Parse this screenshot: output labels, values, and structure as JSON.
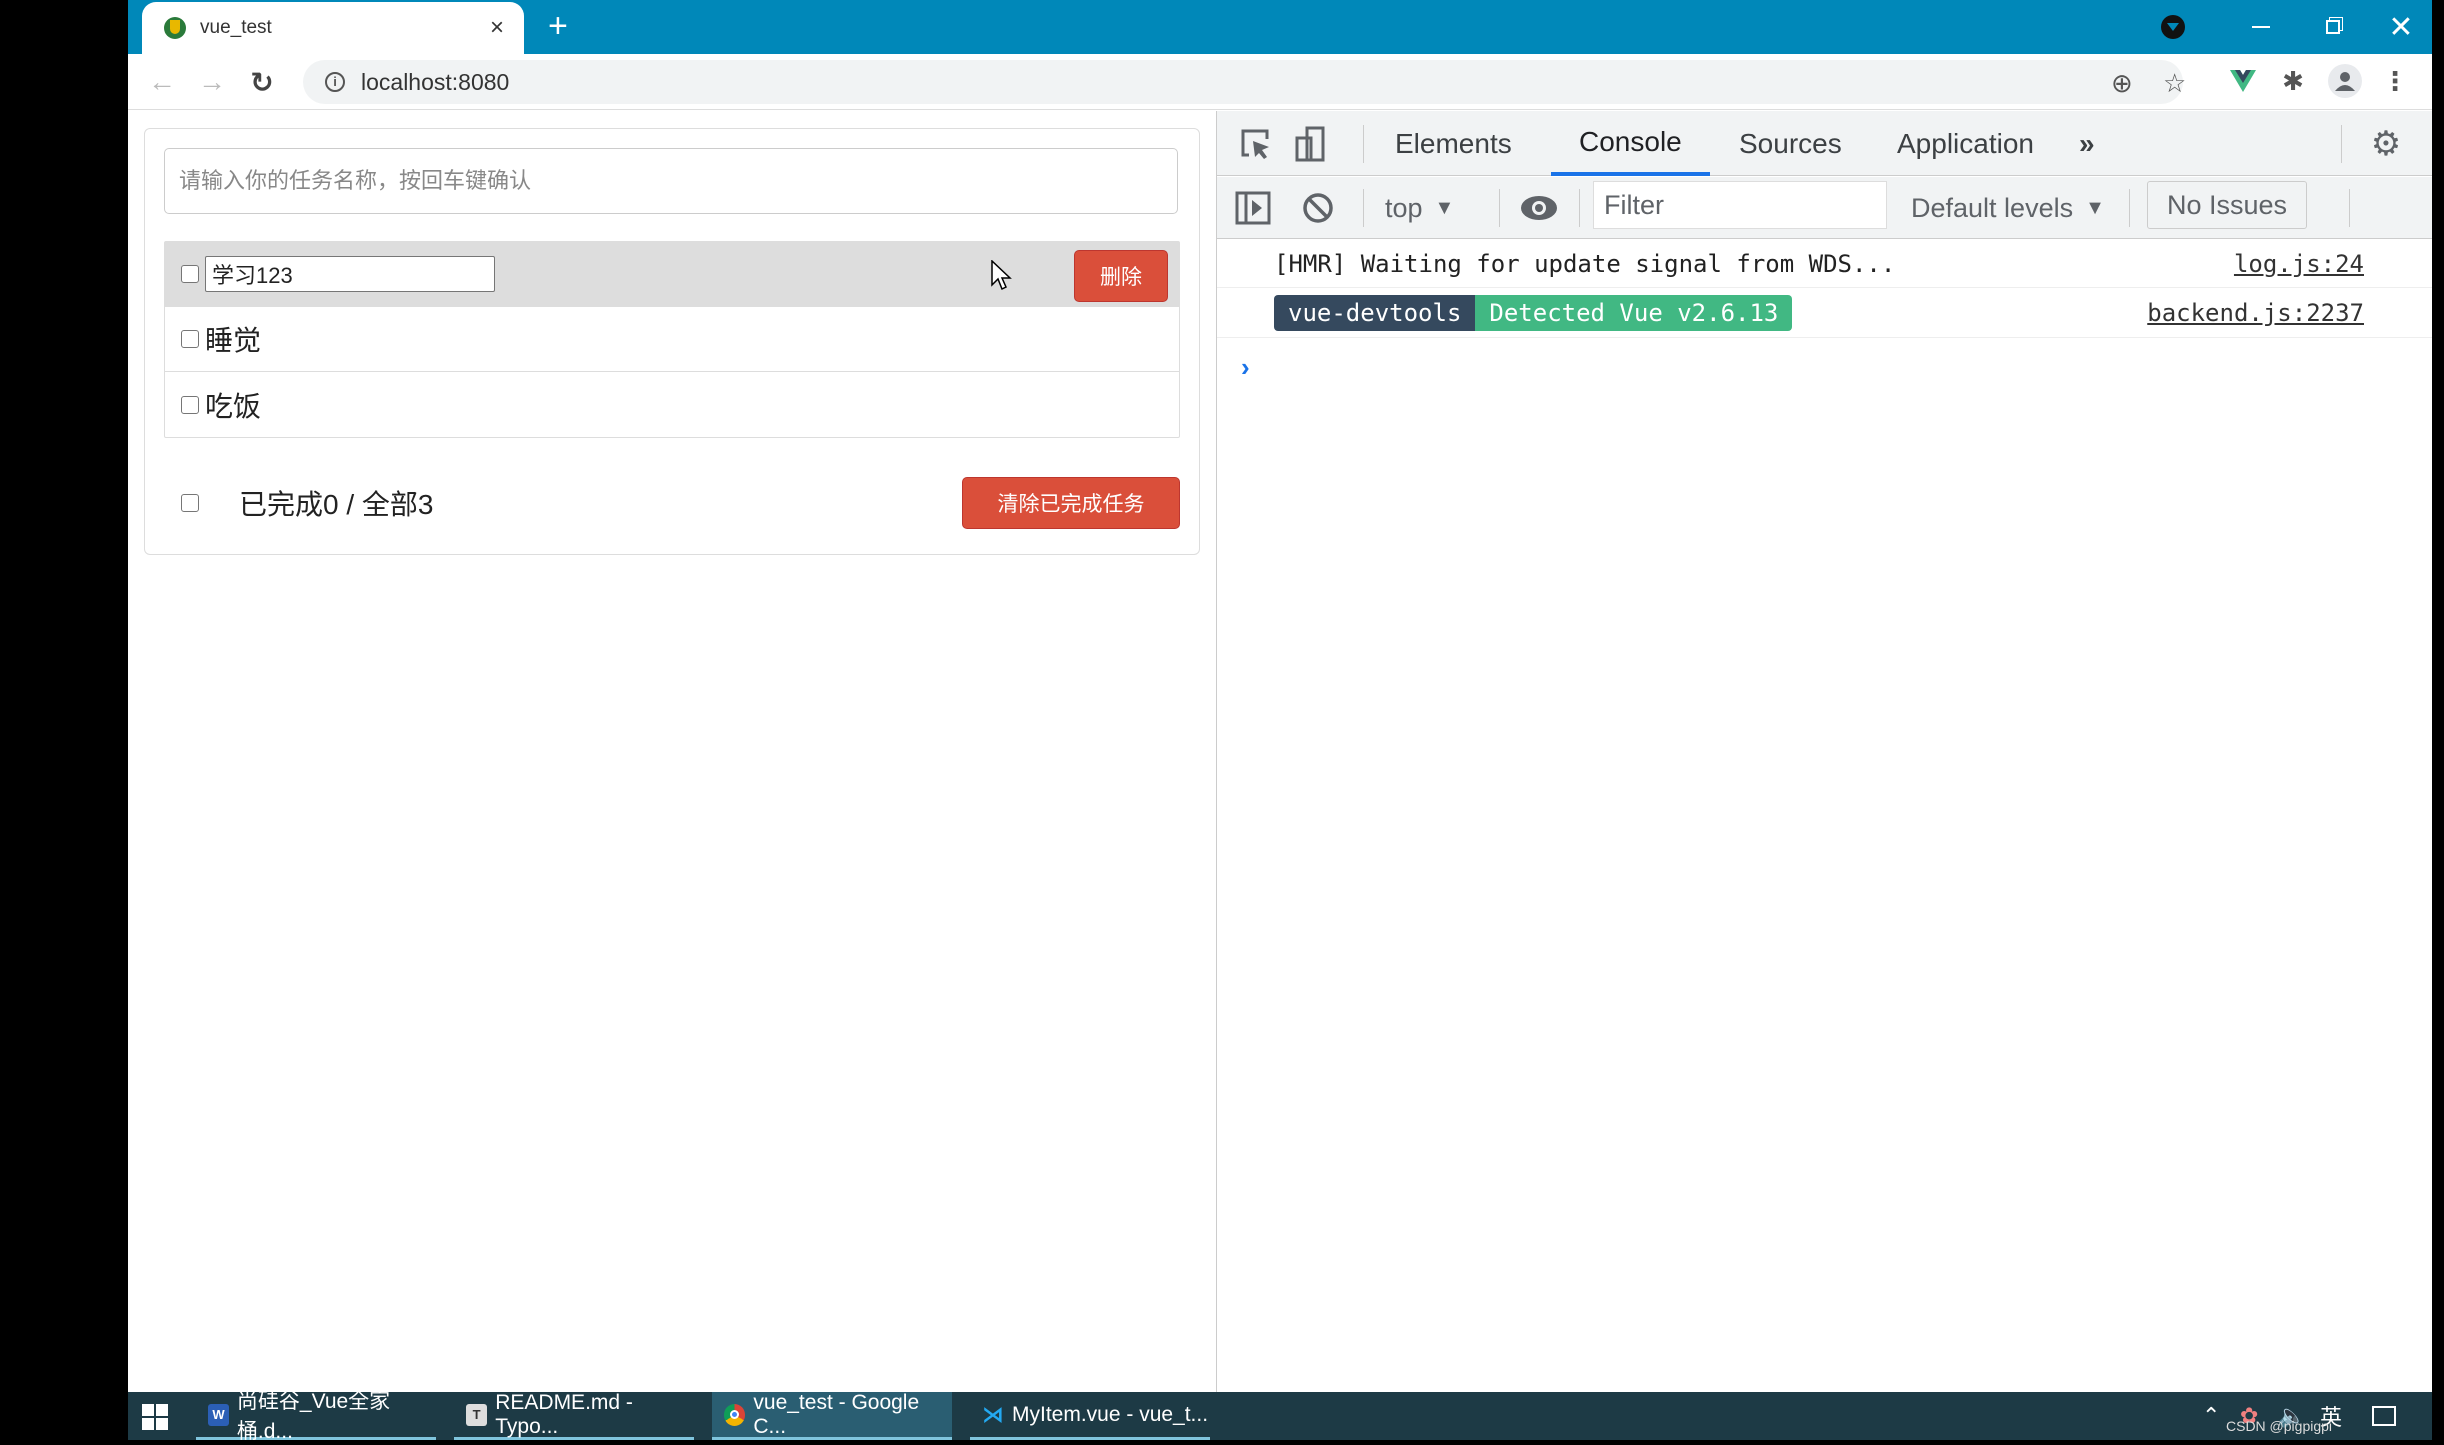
{
  "browser": {
    "tab_title": "vue_test",
    "url": "localhost:8080",
    "new_tab_symbol": "+",
    "close_tab_symbol": "×"
  },
  "todo": {
    "input_placeholder": "请输入你的任务名称，按回车键确认",
    "input_value": "",
    "items": [
      {
        "title": "学习123",
        "done": false,
        "editing": true,
        "hovered": true
      },
      {
        "title": "睡觉",
        "done": false,
        "editing": false,
        "hovered": false
      },
      {
        "title": "吃饭",
        "done": false,
        "editing": false,
        "hovered": false
      }
    ],
    "delete_label": "删除",
    "footer": {
      "done_count": 0,
      "total_count": 3,
      "count_text": "已完成0 / 全部3",
      "clear_label": "清除已完成任务"
    }
  },
  "devtools": {
    "tabs": [
      "Elements",
      "Console",
      "Sources",
      "Application"
    ],
    "active_tab": "Console",
    "more_tabs_symbol": "»",
    "context": "top",
    "filter_placeholder": "Filter",
    "levels": "Default levels",
    "issues": "No Issues",
    "logs": [
      {
        "text": "[HMR] Waiting for update signal from WDS...",
        "source": "log.js:24"
      },
      {
        "badge_left": "vue-devtools",
        "badge_right": "Detected Vue v2.6.13",
        "source": "backend.js:2237"
      }
    ],
    "prompt_symbol": "›"
  },
  "taskbar": {
    "apps": [
      {
        "label": "尚硅谷_Vue全家桶.d...",
        "icon": "word-icon",
        "active": false
      },
      {
        "label": "README.md - Typo...",
        "icon": "typora-icon",
        "active": false
      },
      {
        "label": "vue_test - Google C...",
        "icon": "chrome-icon",
        "active": true
      },
      {
        "label": "MyItem.vue - vue_t...",
        "icon": "vscode-icon",
        "active": false
      }
    ],
    "ime": "英",
    "watermark": "CSDN @pigpigpi"
  },
  "colors": {
    "titlebar": "#0088b9",
    "danger": "#da4f3a",
    "vue_dark": "#35495e",
    "vue_green": "#41b883",
    "devtools_accent": "#1a73e8",
    "taskbar": "#1d3a45"
  }
}
